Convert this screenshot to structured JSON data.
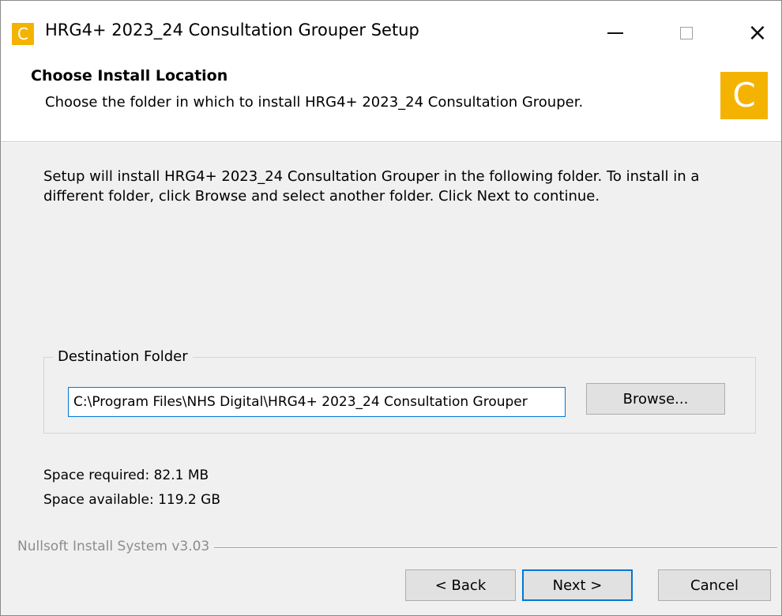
{
  "window": {
    "title": "HRG4+ 2023_24 Consultation Grouper Setup",
    "app_icon_letter": "C",
    "accent_color": "#f5b301",
    "minimize_icon": "minimize-icon",
    "maximize_icon": "maximize-icon",
    "close_glyph": "×"
  },
  "header": {
    "title": "Choose Install Location",
    "subtitle": "Choose the folder in which to install HRG4+ 2023_24 Consultation Grouper.",
    "logo_letter": "C"
  },
  "body": {
    "intro": "Setup will install HRG4+ 2023_24 Consultation Grouper in the following folder. To install in a different folder, click Browse and select another folder. Click Next to continue.",
    "destination": {
      "label": "Destination Folder",
      "path": "C:\\Program Files\\NHS Digital\\HRG4+ 2023_24 Consultation Grouper",
      "browse_label": "Browse..."
    },
    "space_required": "Space required: 82.1 MB",
    "space_available": "Space available: 119.2 GB"
  },
  "footer": {
    "branding": "Nullsoft Install System v3.03",
    "back_label": "< Back",
    "next_label": "Next >",
    "cancel_label": "Cancel"
  }
}
